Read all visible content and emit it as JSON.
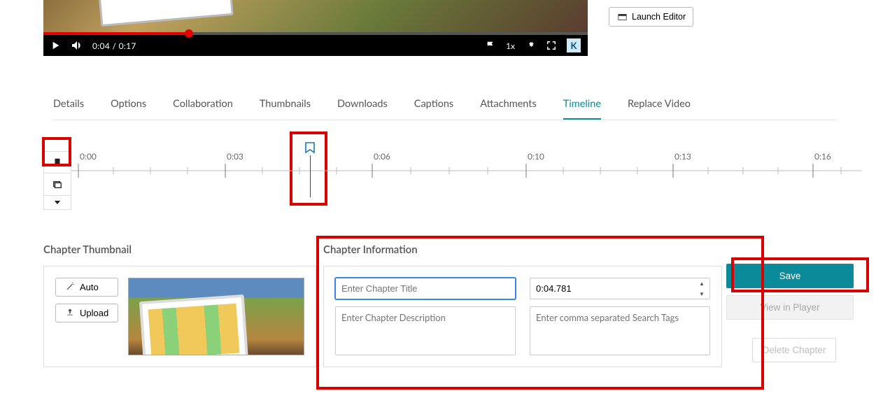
{
  "player": {
    "current_time": "0:04",
    "total_time": "0:17",
    "speed_label": "1x",
    "brand_letter": "K"
  },
  "side_actions": {
    "launch_editor_label": "Launch Editor"
  },
  "tabs": [
    {
      "label": "Details",
      "active": false
    },
    {
      "label": "Options",
      "active": false
    },
    {
      "label": "Collaboration",
      "active": false
    },
    {
      "label": "Thumbnails",
      "active": false
    },
    {
      "label": "Downloads",
      "active": false
    },
    {
      "label": "Captions",
      "active": false
    },
    {
      "label": "Attachments",
      "active": false
    },
    {
      "label": "Timeline",
      "active": true
    },
    {
      "label": "Replace Video",
      "active": false
    }
  ],
  "timeline": {
    "ticks": [
      "0:00",
      "0:03",
      "0:06",
      "0:10",
      "0:13",
      "0:16"
    ]
  },
  "chapter_thumbnail": {
    "title": "Chapter Thumbnail",
    "auto_label": "Auto",
    "upload_label": "Upload"
  },
  "chapter_info": {
    "title": "Chapter Information",
    "title_placeholder": "Enter Chapter Title",
    "title_value": "",
    "time_value": "0:04.781",
    "desc_placeholder": "Enter Chapter Description",
    "desc_value": "",
    "tags_placeholder": "Enter comma separated Search Tags",
    "tags_value": ""
  },
  "actions": {
    "save_label": "Save",
    "view_in_player_label": "View in Player",
    "delete_label": "Delete Chapter"
  }
}
